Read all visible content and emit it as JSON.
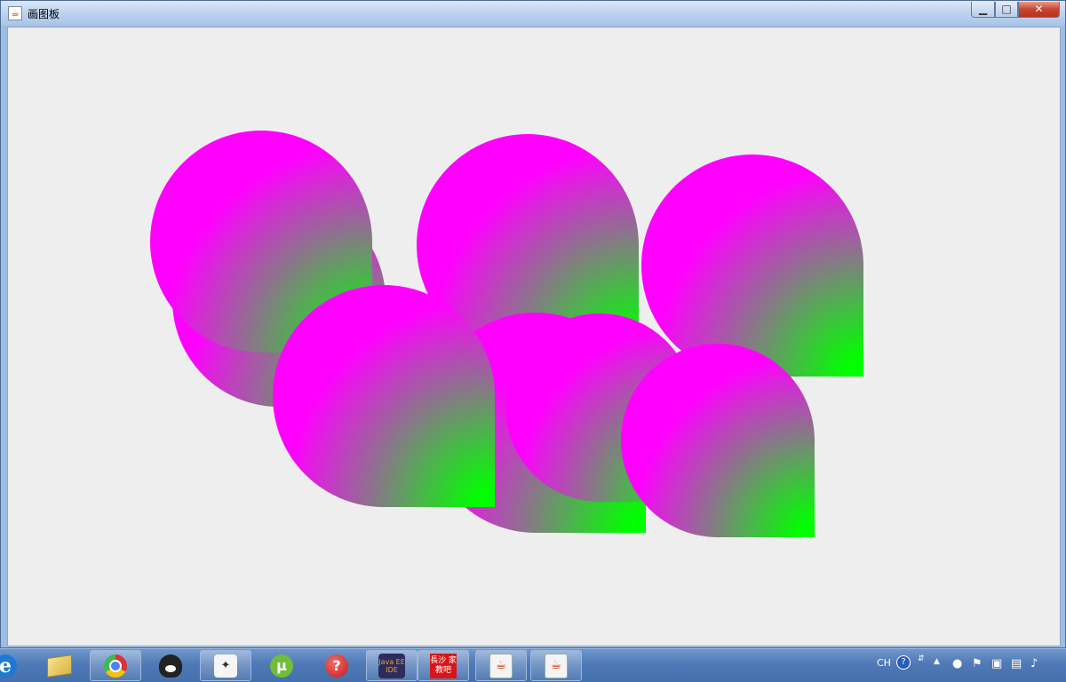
{
  "window": {
    "title": "画图板",
    "min_glyph": "▁",
    "max_glyph": "□",
    "close_glyph": "✕"
  },
  "colors": {
    "shape_outer": "#ff00ff",
    "shape_inner": "#00ff00",
    "canvas_bg": "#eeeeee"
  },
  "taskbar": {
    "items": [
      {
        "name": "ie-icon"
      },
      {
        "name": "file-explorer-icon"
      },
      {
        "name": "chrome-icon"
      },
      {
        "name": "qq-penguin-icon"
      },
      {
        "name": "foxmail-icon"
      },
      {
        "name": "utorrent-icon"
      },
      {
        "name": "help-icon"
      },
      {
        "name": "java-ee-ide-icon",
        "label": "Java EE IDE"
      },
      {
        "name": "changsha-jiajiaoba-icon",
        "label": "長沙 家教吧"
      },
      {
        "name": "java-app-icon-1"
      },
      {
        "name": "java-app-icon-2"
      }
    ],
    "tray": {
      "lang": "CH"
    }
  }
}
